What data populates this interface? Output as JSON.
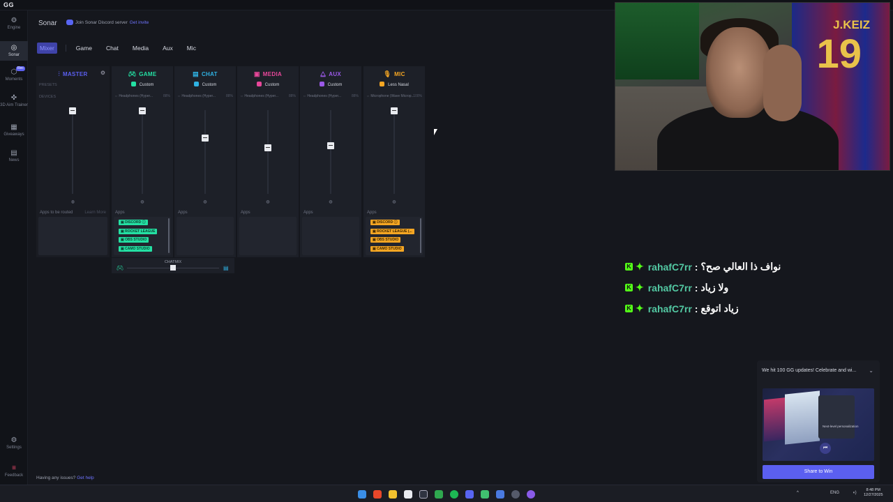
{
  "app": {
    "logo": "GG"
  },
  "rail": {
    "items": [
      {
        "label": "Engine",
        "icon": "engine-icon",
        "glyph": "⚙"
      },
      {
        "label": "Sonar",
        "icon": "sonar-icon",
        "glyph": "◎"
      },
      {
        "label": "Moments",
        "icon": "moments-icon",
        "glyph": "⬡",
        "badge": "Rec"
      },
      {
        "label": "3D Aim Trainer",
        "icon": "aim-trainer-icon",
        "glyph": "✜"
      },
      {
        "label": "Giveaways",
        "icon": "giveaways-icon",
        "glyph": "▦"
      },
      {
        "label": "News",
        "icon": "news-icon",
        "glyph": "▤"
      },
      {
        "label": "Settings",
        "icon": "settings-icon",
        "glyph": "⚙"
      },
      {
        "label": "Feedback",
        "icon": "feedback-icon",
        "glyph": "≡"
      }
    ]
  },
  "header": {
    "title": "Sonar",
    "discord_text": "Join Sonar Discord server",
    "discord_link": "Get invite"
  },
  "tabs": [
    "Mixer",
    "Game",
    "Chat",
    "Media",
    "Aux",
    "Mic"
  ],
  "mixer": {
    "master": {
      "title": "MASTER",
      "presets_label": "PRESETS",
      "devices_label": "DEVICES",
      "apps_label": "Apps to be routed",
      "learn_more": "Learn More",
      "level": 1.0
    },
    "channels": [
      {
        "title": "GAME",
        "color": "#24e0a3",
        "preset": "Custom",
        "device": "Headphones (Hyper...",
        "device_pct": "88%",
        "level": 1.0,
        "apps": [
          "DISCORD",
          "ROCKET LEAGUE",
          "OBS STUDIO",
          "CAMO STUDIO"
        ]
      },
      {
        "title": "CHAT",
        "color": "#2fb2e3",
        "preset": "Custom",
        "device": "Headphones (Hyper...",
        "device_pct": "88%",
        "level": 0.65,
        "apps": []
      },
      {
        "title": "MEDIA",
        "color": "#e8479a",
        "preset": "Custom",
        "device": "Headphones (Hyper...",
        "device_pct": "88%",
        "level": 0.52,
        "apps": []
      },
      {
        "title": "AUX",
        "color": "#9b59e8",
        "preset": "Custom",
        "device": "Headphones (Hyper...",
        "device_pct": "88%",
        "level": 0.55,
        "apps": []
      },
      {
        "title": "MIC",
        "color": "#f5a623",
        "preset": "Less Nasal",
        "device": "Microphone (Wave Microp...",
        "device_pct": "100%",
        "level": 1.0,
        "apps": [
          "DISCORD",
          "ROCKET LEAGUE (...",
          "OBS STUDIO",
          "CAMO STUDIO"
        ]
      }
    ],
    "apps_label": "Apps",
    "chatmix_label": "CHATMIX"
  },
  "chat": [
    {
      "user": "rahafC7rr",
      "message": "نواف ذا العالي صح؟"
    },
    {
      "user": "rahafC7rr",
      "message": "ولا زياد"
    },
    {
      "user": "rahafC7rr",
      "message": "زياد اتوقع"
    }
  ],
  "webcam": {
    "jersey_name": "J.KEIZ",
    "jersey_number": "19"
  },
  "notification": {
    "title": "We hit 100 GG updates! Celebrate and wi...",
    "image_text": "Next-level personalization",
    "cta": "Share to Win"
  },
  "footer": {
    "help_text": "Having any issues?",
    "help_link": "Get help"
  },
  "taskbar": {
    "lang": "ENG",
    "time": "8:48 PM",
    "date": "12/27/2025"
  }
}
